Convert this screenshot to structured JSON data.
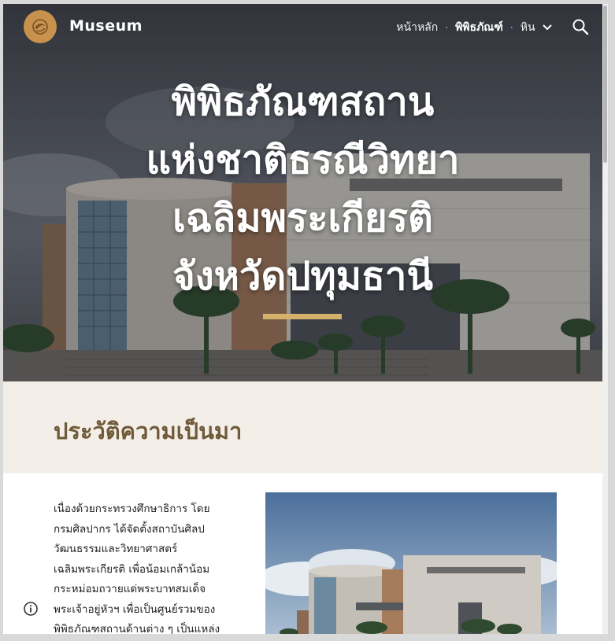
{
  "header": {
    "site_name": "Museum",
    "logo_icon": "museum-logo-icon",
    "nav": [
      {
        "label": "หน้าหลัก",
        "active": false
      },
      {
        "label": "พิพิธภัณฑ์",
        "active": true
      },
      {
        "label": "หิน",
        "active": false,
        "has_dropdown": true
      }
    ],
    "search_icon": "search-icon"
  },
  "hero": {
    "title_lines": [
      "พิพิธภัณฑสถาน",
      "แห่งชาติธรณีวิทยา",
      "เฉลิมพระเกียรติ",
      "จังหวัดปทุมธานี"
    ]
  },
  "section": {
    "title": "ประวัติความเป็นมา"
  },
  "content": {
    "paragraph_lines": [
      "เนื่องด้วยกระทรวงศึกษาธิการ โดย",
      "กรมศิลปากร ได้จัดตั้งสถาบันศิลป",
      "วัฒนธรรมและวิทยาศาสตร์",
      "เฉลิมพระเกียรติ เพื่อน้อมเกล้าน้อม",
      "กระหม่อมถวายแด่พระบาทสมเด็จ",
      "พระเจ้าอยู่หัวฯ เพื่อเป็นศูนย์รวมของ",
      "พิพิธภัณฑสถานด้านต่าง ๆ เป็นแหล่ง"
    ]
  },
  "info_icon": "info-icon",
  "colors": {
    "accent": "#d4b06a",
    "section_title": "#705a39",
    "section_bg": "#f3efe8",
    "logo_bg": "#c8924e"
  }
}
